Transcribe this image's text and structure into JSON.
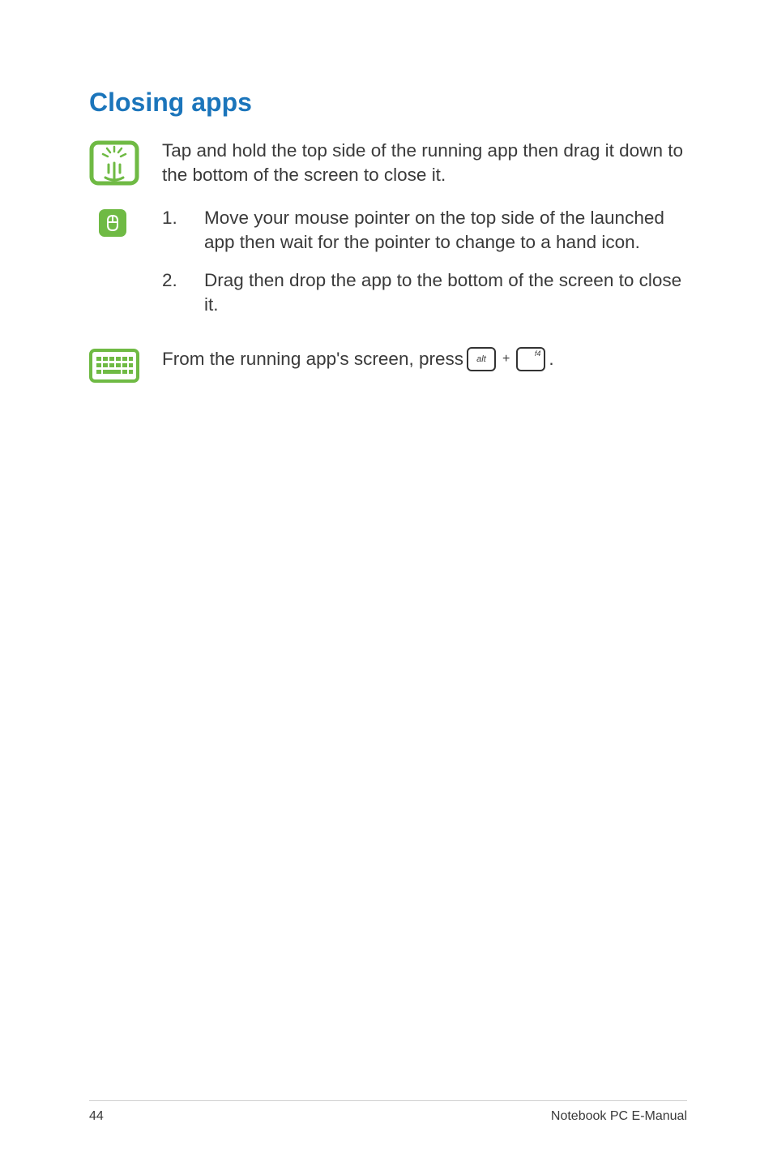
{
  "heading": "Closing apps",
  "touch": {
    "text": "Tap and hold the top side of the running app then drag it down to the bottom of the screen to close it."
  },
  "mouse": {
    "steps": [
      {
        "num": "1.",
        "text": "Move your mouse pointer on the top side of the launched app then wait for the pointer to change to a hand icon."
      },
      {
        "num": "2.",
        "text": "Drag then drop the app to the bottom of the screen to close it."
      }
    ]
  },
  "keyboard": {
    "prefix": "From the running app's screen, press ",
    "key1": "alt",
    "plus": "+",
    "key2": "f4",
    "suffix": "."
  },
  "footer": {
    "page": "44",
    "title": "Notebook PC E-Manual"
  }
}
